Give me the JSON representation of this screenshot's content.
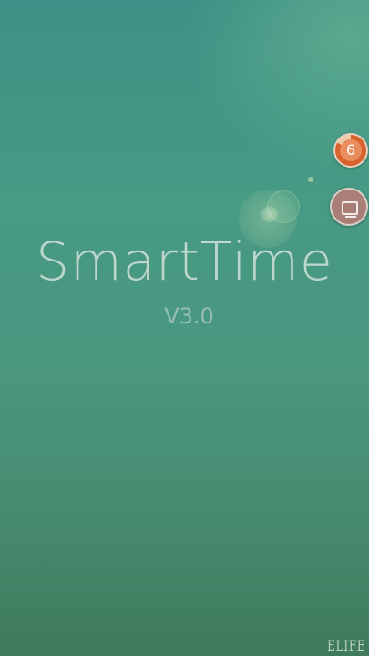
{
  "app": {
    "title": "SmartTime",
    "version": "V3.0"
  },
  "floating_badge": {
    "count": "6",
    "ring_color": "#d8622e",
    "icon": "progress-ring-icon"
  },
  "floating_button": {
    "icon": "screen-icon",
    "color": "#a97f77"
  },
  "watermark": {
    "text": "ELIFE"
  },
  "colors": {
    "background_top": "#3f8f86",
    "background_bottom": "#3f7a5c",
    "title_text": "#dee8e2"
  }
}
